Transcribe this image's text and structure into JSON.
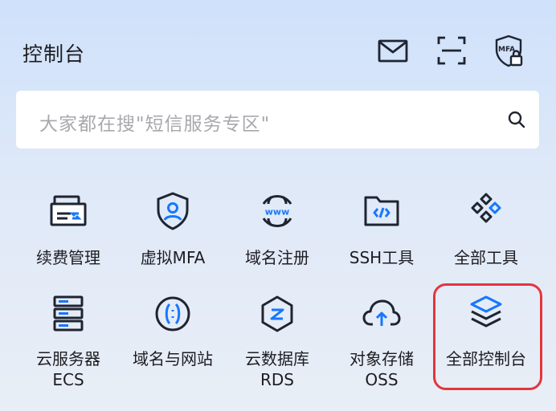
{
  "header": {
    "title": "控制台",
    "icons": [
      "mail-icon",
      "scan-icon",
      "mfa-lock-icon"
    ],
    "mfa_icon_text": "MFA"
  },
  "search": {
    "placeholder": "大家都在搜\"短信服务专区\"",
    "icon": "search-icon"
  },
  "colors": {
    "accent_blue": "#1677ff",
    "icon_dark": "#1f2430",
    "highlight_red": "#e2363c"
  },
  "tools_row1": [
    {
      "label": "续费管理",
      "icon": "renew-icon"
    },
    {
      "label": "虚拟MFA",
      "icon": "shield-user-icon"
    },
    {
      "label": "域名注册",
      "icon": "globe-www-icon"
    },
    {
      "label": "SSH工具",
      "icon": "folder-code-icon"
    },
    {
      "label": "全部工具",
      "icon": "grid-diamonds-icon"
    }
  ],
  "tools_row2": [
    {
      "label_line1": "云服务器",
      "label_line2": "ECS",
      "icon": "server-stack-icon"
    },
    {
      "label_line1": "域名与网站",
      "label_line2": "",
      "icon": "brackets-circle-icon"
    },
    {
      "label_line1": "云数据库",
      "label_line2": "RDS",
      "icon": "database-hex-icon"
    },
    {
      "label_line1": "对象存储",
      "label_line2": "OSS",
      "icon": "cloud-upload-icon"
    },
    {
      "label_line1": "全部控制台",
      "label_line2": "",
      "icon": "layers-icon"
    }
  ]
}
